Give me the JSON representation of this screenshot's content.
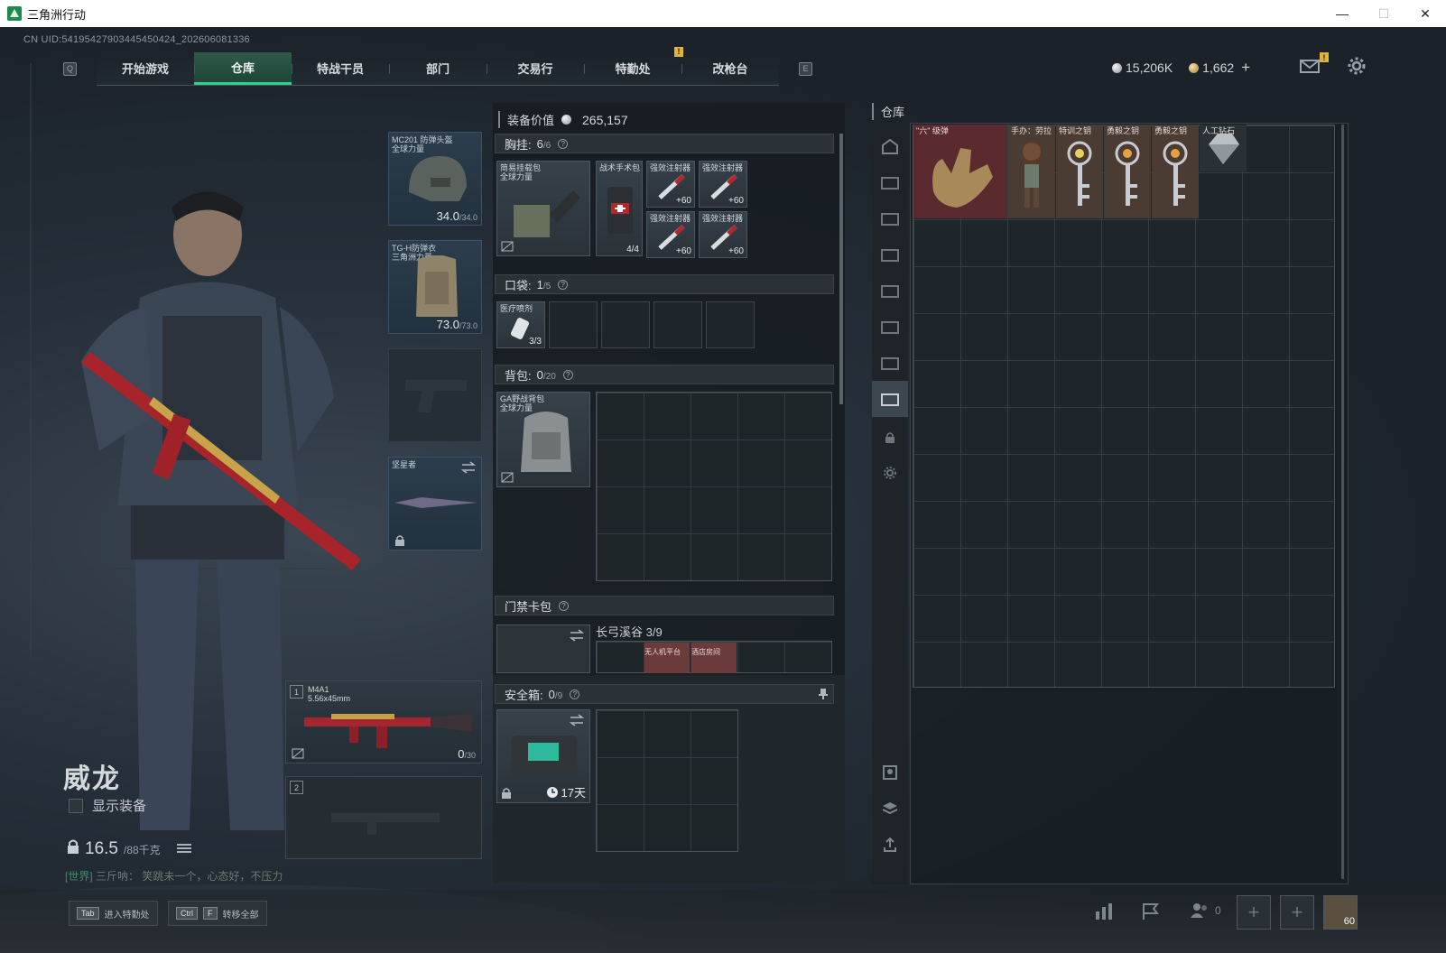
{
  "window": {
    "title": "三角洲行动",
    "controls": [
      "—",
      "☐",
      "✕"
    ]
  },
  "uid": "CN UID:54195427903445450424_202606081336",
  "nav": {
    "left_key": "Q",
    "right_key": "E",
    "tabs": [
      "开始游戏",
      "仓库",
      "特战干员",
      "部门",
      "交易行",
      "特勤处",
      "改枪台"
    ],
    "active_tab": "仓库",
    "badge": "!"
  },
  "currency": {
    "silver": "15,206K",
    "gold": "1,662",
    "add": "+"
  },
  "mail_badge": "!",
  "operator": {
    "name": "威龙",
    "show_equipment": "显示装备",
    "weight": "16.5",
    "weight_max": "/88千克"
  },
  "chat": {
    "channel": "[世界]",
    "text": "三斤呐：  笑跳未一个，心态好，不压力"
  },
  "equipment": {
    "helmet": {
      "name": "MC201 防弹头盔",
      "sub": "全球力量",
      "durability": "34.0",
      "durability_max": "/34.0"
    },
    "armor": {
      "name": "TG-H防弹衣",
      "sub": "三角洲力量",
      "durability": "73.0",
      "durability_max": "/73.0"
    },
    "melee": {
      "name": "坚星者"
    },
    "primary": {
      "num": "1",
      "name": "M4A1",
      "caliber": "5.56x45mm",
      "ammo": "0",
      "ammo_max": "/30"
    },
    "secondary": {
      "num": "2"
    }
  },
  "loadout": {
    "value_label": "装备价值",
    "value": "265,157",
    "rig": {
      "label": "胸挂:",
      "count": "6",
      "max": "/6",
      "container": {
        "name": "简易挂载包",
        "sub": "全球力量"
      },
      "items": [
        {
          "name": "战术手术包",
          "qty": "4/4"
        },
        {
          "name": "强效注射器",
          "qty": "+60"
        },
        {
          "name": "强效注射器",
          "qty": "+60"
        },
        {
          "name": "强效注射器",
          "qty": "+60"
        },
        {
          "name": "强效注射器",
          "qty": "+60"
        }
      ]
    },
    "pocket": {
      "label": "口袋:",
      "count": "1",
      "max": "/5",
      "item": {
        "name": "医疗喷剂",
        "qty": "3/3"
      }
    },
    "backpack": {
      "label": "背包:",
      "count": "0",
      "max": "/20",
      "item": {
        "name": "GA野战背包",
        "sub": "全球力量"
      }
    },
    "keycard": {
      "label": "门禁卡包",
      "map": "长弓溪谷",
      "count": "3/9",
      "cards": [
        "无人机平台",
        "酒店房间"
      ]
    },
    "safebox": {
      "label": "安全箱:",
      "count": "0",
      "max": "/9",
      "timer": "17天"
    }
  },
  "warehouse": {
    "title": "仓库",
    "items": [
      {
        "name": "\"六\" 级弹",
        "color": "#5a2a2e"
      },
      {
        "name": "手办：劳拉",
        "color": "#4a3b33"
      },
      {
        "name": "特训之钥",
        "color": "#4a3b33"
      },
      {
        "name": "勇毅之钥",
        "color": "#4a3b33"
      },
      {
        "name": "勇毅之钥",
        "color": "#4a3b33"
      },
      {
        "name": "人工钻石",
        "color": "#2a3136"
      }
    ]
  },
  "bottom": {
    "hint1": {
      "key": "Tab",
      "text": "进入特勤处"
    },
    "hint2": {
      "key1": "Ctrl",
      "key2": "F",
      "text": "转移全部"
    },
    "friends": "0",
    "plus": "+",
    "avatar_level": "60"
  }
}
